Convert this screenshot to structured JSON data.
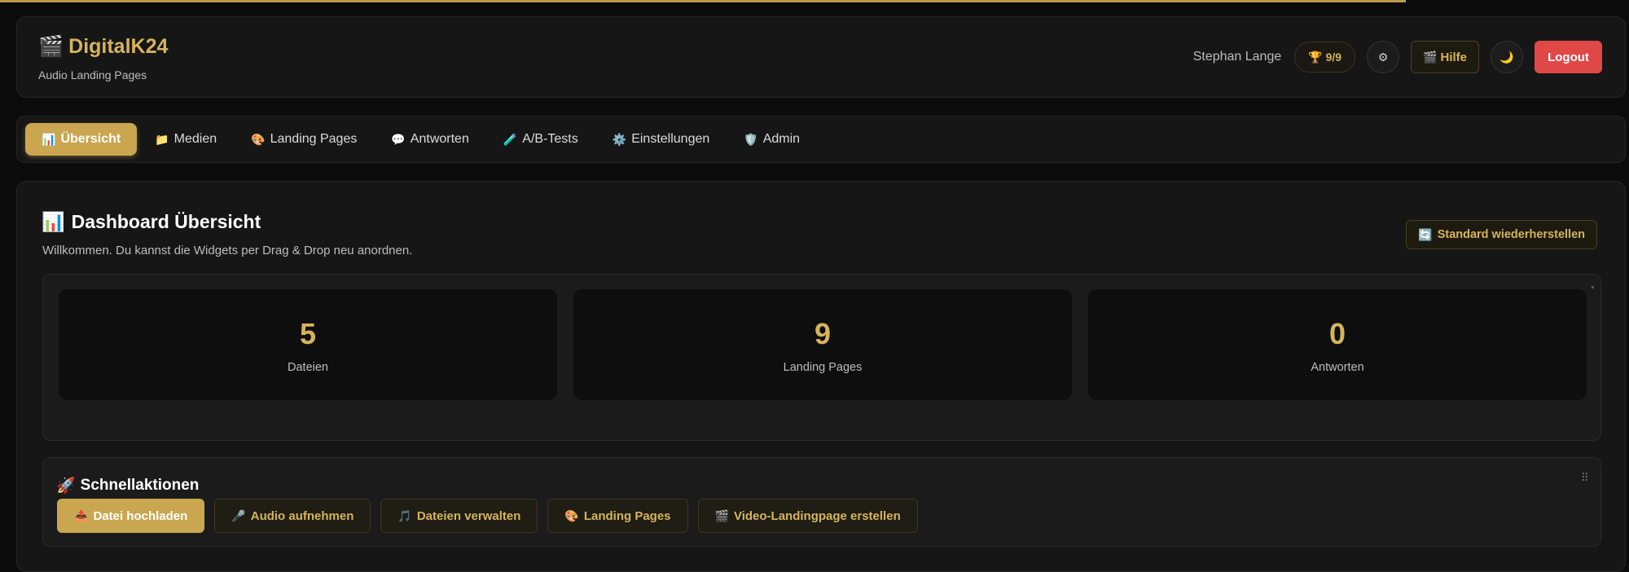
{
  "header": {
    "brand_icon": "clapper-icon",
    "brand_title": "DigitalK24",
    "brand_subtitle": "Audio Landing Pages",
    "user_name": "Stephan Lange",
    "trophy_count": "9/9",
    "help_label": "Hilfe",
    "logout_label": "Logout"
  },
  "nav": {
    "items": [
      {
        "icon": "📊",
        "label": "Übersicht"
      },
      {
        "icon": "📁",
        "label": "Medien"
      },
      {
        "icon": "🎨",
        "label": "Landing Pages"
      },
      {
        "icon": "💬",
        "label": "Antworten"
      },
      {
        "icon": "🧪",
        "label": "A/B-Tests"
      },
      {
        "icon": "⚙️",
        "label": "Einstellungen"
      },
      {
        "icon": "🛡️",
        "label": "Admin"
      }
    ]
  },
  "main": {
    "title_icon": "📊",
    "title": "Dashboard Übersicht",
    "subtitle": "Willkommen. Du kannst die Widgets per Drag & Drop neu anordnen.",
    "reset_label": "Standard wiederherstellen"
  },
  "stats": [
    {
      "value": "5",
      "label": "Dateien"
    },
    {
      "value": "9",
      "label": "Landing Pages"
    },
    {
      "value": "0",
      "label": "Antworten"
    }
  ],
  "quick": {
    "title_icon": "🚀",
    "title": "Schnellaktionen",
    "actions": [
      {
        "icon": "📤",
        "label": "Datei hochladen"
      },
      {
        "icon": "🎤",
        "label": "Audio aufnehmen"
      },
      {
        "icon": "🎵",
        "label": "Dateien verwalten"
      },
      {
        "icon": "🎨",
        "label": "Landing Pages"
      },
      {
        "icon": "🎬",
        "label": "Video-Landingpage erstellen"
      }
    ]
  },
  "colors": {
    "accent": "#c9a64f",
    "logout": "#e04848",
    "background": "#0b0b0b"
  }
}
